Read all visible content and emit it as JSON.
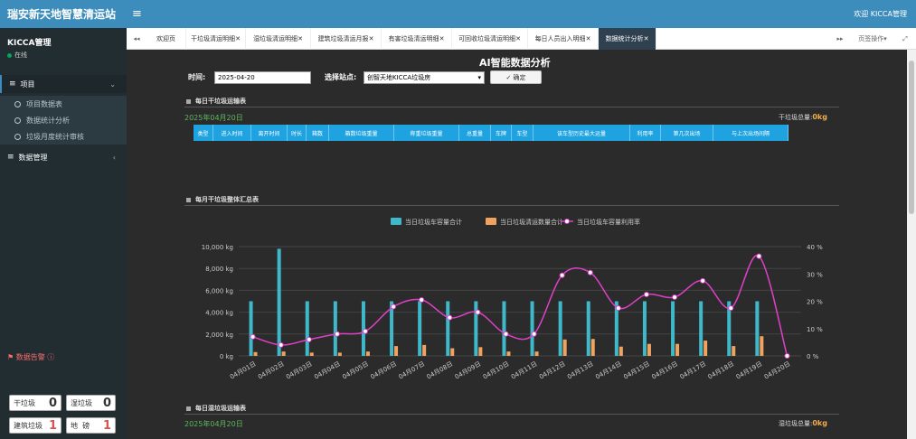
{
  "app": {
    "brand": "瑞安新天地智慧清运站",
    "welcome": "欢迎 KICCA管理"
  },
  "user": {
    "name": "KICCA管理",
    "status": "在线"
  },
  "sidebar": {
    "menu1": "项目",
    "sub": [
      "项目数据表",
      "数据统计分析",
      "垃圾月度统计审核"
    ],
    "menu2": "数据管理"
  },
  "alarm": {
    "title": "数据告警",
    "items": [
      {
        "label": "干垃圾",
        "count": "0"
      },
      {
        "label": "湿垃圾",
        "count": "0"
      },
      {
        "label": "建筑垃圾",
        "count": "1"
      },
      {
        "label": "地  磅",
        "count": "1"
      }
    ]
  },
  "tabs": [
    "欢迎页",
    "干垃圾清运明细",
    "湿垃圾清运明细",
    "建筑垃圾清运月报",
    "有害垃圾清运明细",
    "可回收垃圾清运明细",
    "每日人员出入明细",
    "数据统计分析"
  ],
  "tab_controls": {
    "page_ops": "页签操作"
  },
  "page": {
    "title": "AI智能数据分析",
    "time_label": "时间:",
    "date_value": "2025-04-20",
    "station_label": "选择站点:",
    "station_value": "创智天地KICCA垃圾房",
    "confirm": "确定"
  },
  "section1": {
    "title": "每日干垃圾运输表",
    "date": "2025年04月20日",
    "total_label": "干垃圾总量:",
    "total_value": "0kg",
    "columns": [
      "类型",
      "进入时间",
      "离开时间",
      "时长",
      "箱数",
      "箱数垃圾重量",
      "称重垃圾重量",
      "总重量",
      "车牌",
      "车型",
      "该车型历史最大运量",
      "利用率",
      "第几次出场",
      "与上次出场间隔"
    ]
  },
  "section2": {
    "title": "每月干垃圾整体汇总表"
  },
  "section3": {
    "title": "每日湿垃圾运输表",
    "date": "2025年04月20日",
    "total_label": "湿垃圾总量:",
    "total_value": "0kg"
  },
  "chart_data": {
    "type": "bar",
    "categories": [
      "04月01日",
      "04月02日",
      "04月03日",
      "04月04日",
      "04月05日",
      "04月06日",
      "04月07日",
      "04月08日",
      "04月09日",
      "04月10日",
      "04月11日",
      "04月12日",
      "04月13日",
      "04月14日",
      "04月15日",
      "04月16日",
      "04月17日",
      "04月18日",
      "04月19日",
      "04月20日"
    ],
    "series": [
      {
        "name": "当日垃圾车容量合计",
        "type": "bar",
        "axis": "left",
        "color": "#3fb8c9",
        "values": [
          5000,
          9800,
          5000,
          5000,
          5000,
          5000,
          5000,
          5000,
          5000,
          5000,
          5000,
          5000,
          5000,
          5000,
          5000,
          5000,
          5000,
          5000,
          5000,
          0
        ]
      },
      {
        "name": "当日垃圾清运数量合计",
        "type": "bar",
        "axis": "left",
        "color": "#f0a35e",
        "values": [
          350,
          400,
          300,
          300,
          400,
          900,
          1000,
          700,
          800,
          400,
          400,
          1500,
          1550,
          850,
          1100,
          1100,
          1400,
          900,
          1800,
          0
        ]
      },
      {
        "name": "当日垃圾车容量利用率",
        "type": "line",
        "axis": "right",
        "color": "#e040c8",
        "values": [
          7,
          4,
          6,
          8,
          9,
          18,
          20.5,
          14,
          16,
          8,
          8,
          29.5,
          30.5,
          17.5,
          22.5,
          21.5,
          27.5,
          17.5,
          36.5,
          0
        ]
      }
    ],
    "y_left": {
      "min": 0,
      "max": 10000,
      "ticks": [
        "0 kg",
        "2,000 kg",
        "4,000 kg",
        "6,000 kg",
        "8,000 kg",
        "10,000 kg"
      ]
    },
    "y_right": {
      "min": 0,
      "max": 40,
      "ticks": [
        "0 %",
        "10 %",
        "20 %",
        "30 %",
        "40 %"
      ]
    },
    "legend": "top-center",
    "grid": true
  }
}
